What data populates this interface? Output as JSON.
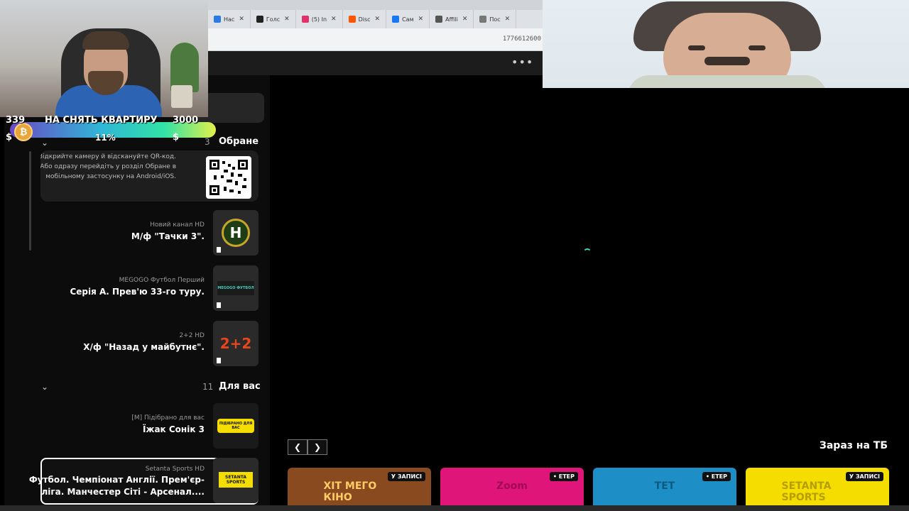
{
  "browser": {
    "tabs": [
      {
        "label": "Нас",
        "icon": "gear-icon",
        "color": "#2c7be5"
      },
      {
        "label": "Голс",
        "icon": "app-icon",
        "color": "#222222"
      },
      {
        "label": "(5) Іn",
        "icon": "instagram-icon",
        "color": "#e1306c"
      },
      {
        "label": "Disc",
        "icon": "soundcloud-icon",
        "color": "#ff5500"
      },
      {
        "label": "Сам",
        "icon": "pin-icon",
        "color": "#1877f2"
      },
      {
        "label": "Affili",
        "icon": "globe-icon",
        "color": "#555555"
      },
      {
        "label": "Пос",
        "icon": "globe-icon",
        "color": "#777777"
      }
    ],
    "address": "1776612600"
  },
  "donation": {
    "current": "339",
    "goal_text": "НА СНЯТЬ КВАРТИРУ",
    "target": "3000",
    "percent": "11%",
    "currency": "$",
    "progress": 0.11
  },
  "sidebar": {
    "favorites_title": "Обране",
    "favorites_count": "3",
    "qr_text": "Відкрийте камеру й відскануйте QR-код. Або одразу перейдіть у розділ Обране в мобільному застосунку на Android/iOS.",
    "favorites": [
      {
        "meta": "Новий канал HD",
        "title": "М/ф \"Тачки 3\".",
        "logo": "Н",
        "bg": "#1f3d14"
      },
      {
        "meta": "MEGOGO Футбол Перший",
        "title": "Серія А. Прев'ю 33-го туру.",
        "logo": "MEGOGO ФУТБОЛ",
        "bg": "#111111"
      },
      {
        "meta": "2+2 HD",
        "title": "Х/ф \"Назад у майбутнє\".",
        "logo": "2+2",
        "bg": "#111111"
      }
    ],
    "foryou_title": "Для вас",
    "foryou_count": "11",
    "foryou": [
      {
        "meta": "[М] Підібрано для вас",
        "title": "Їжак Сонік 3",
        "logo": "ПІДІБРАНО ДЛЯ ВАС",
        "bg": "#f5dd00"
      },
      {
        "meta": "Setanta Sports HD",
        "title_1": "Футбол. Чемпіонат Англії. Прем'єр-",
        "title_2": "ліга. Манчестер Сіті - Арсенал....",
        "logo": "SETANTA SPORTS",
        "bg": "#f5dd00"
      }
    ]
  },
  "main": {
    "now_title": "Зараз на ТБ",
    "cards": [
      {
        "badge": "У ЗАПИСІ",
        "logo": "ХІТ МЕГО КІНО",
        "bg": "#8a4a1f",
        "fg": "#ffcc66"
      },
      {
        "badge": "• ЕТЕР",
        "logo": "Zoom",
        "bg": "#e0157a",
        "fg": "#a10a55"
      },
      {
        "badge": "• ЕТЕР",
        "logo": "ТЕТ",
        "bg": "#1d8fc6",
        "fg": "#0d5a80"
      },
      {
        "badge": "У ЗАПИСІ",
        "logo": "SETANTA SPORTS",
        "bg": "#f5dd00",
        "fg": "#b59f00"
      }
    ]
  }
}
